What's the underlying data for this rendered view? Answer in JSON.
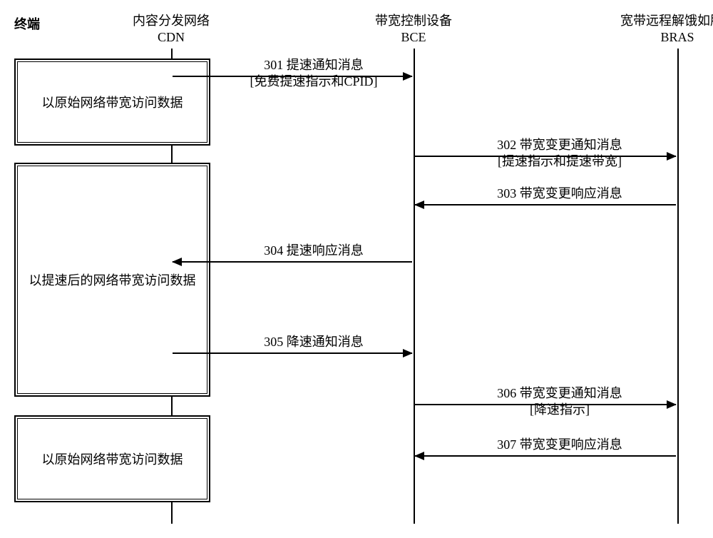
{
  "actors": {
    "terminal": {
      "label": "终端"
    },
    "cdn": {
      "line1": "内容分发网络",
      "line2": "CDN"
    },
    "bce": {
      "line1": "带宽控制设备",
      "line2": "BCE"
    },
    "bras": {
      "line1": "宽带远程解饿如服务器",
      "line2": "BRAS"
    }
  },
  "boxes": {
    "b1": "以原始网络带宽访问数据",
    "b2": "以提速后的网络带宽访问数据",
    "b3": "以原始网络带宽访问数据"
  },
  "messages": {
    "m301": {
      "main": "301 提速通知消息",
      "sub": "[免费提速指示和CPID]"
    },
    "m302": {
      "main": "302 带宽变更通知消息",
      "sub": "[提速指示和提速带宽]"
    },
    "m303": {
      "main": "303 带宽变更响应消息",
      "sub": ""
    },
    "m304": {
      "main": "304 提速响应消息",
      "sub": ""
    },
    "m305": {
      "main": "305 降速通知消息",
      "sub": ""
    },
    "m306": {
      "main": "306 带宽变更通知消息",
      "sub": "[降速指示]"
    },
    "m307": {
      "main": "307 带宽变更响应消息",
      "sub": ""
    }
  }
}
